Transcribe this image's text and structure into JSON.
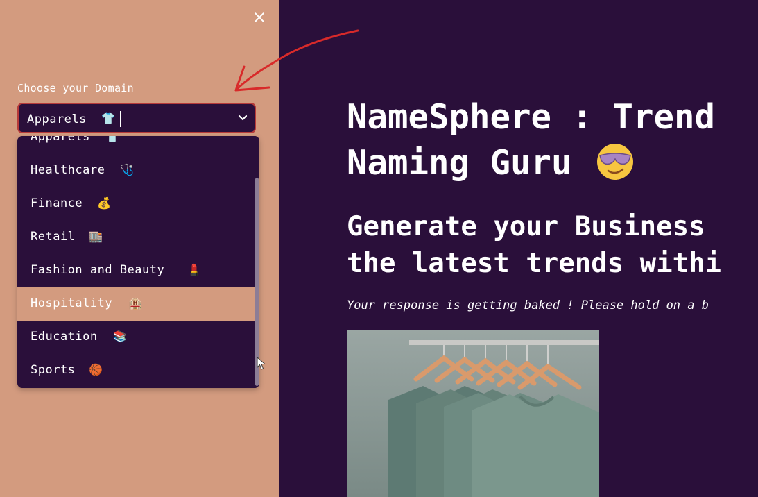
{
  "sidebar": {
    "domain_label": "Choose your Domain",
    "selected_value": "Apparels",
    "selected_emoji": "👕",
    "options": [
      {
        "label": "Apparels",
        "emoji": "👕"
      },
      {
        "label": "Healthcare",
        "emoji": "🩺"
      },
      {
        "label": "Finance",
        "emoji": "💰"
      },
      {
        "label": "Retail",
        "emoji": "🏬"
      },
      {
        "label": "Fashion and Beauty",
        "emoji": "💄"
      },
      {
        "label": "Hospitality",
        "emoji": "🏨"
      },
      {
        "label": "Education",
        "emoji": "📚"
      },
      {
        "label": "Sports",
        "emoji": "🏀"
      }
    ],
    "highlighted_option": "Hospitality"
  },
  "main": {
    "title_line1": "NameSphere : Trend",
    "title_line2": "Naming Guru",
    "title_emoji": "sunglasses-face-icon",
    "subtitle_line1": "Generate your Business",
    "subtitle_line2": "the latest trends withi",
    "status_text": "Your response is getting baked ! Please hold on a b"
  },
  "colors": {
    "sidebar_bg": "#d39b7f",
    "main_bg": "#2a0f3a",
    "select_border": "#b63a3a",
    "annotation_arrow": "#d82a2a"
  },
  "icons": [
    "close-icon",
    "chevron-down-icon",
    "sunglasses-face-icon",
    "mouse-cursor-icon"
  ]
}
